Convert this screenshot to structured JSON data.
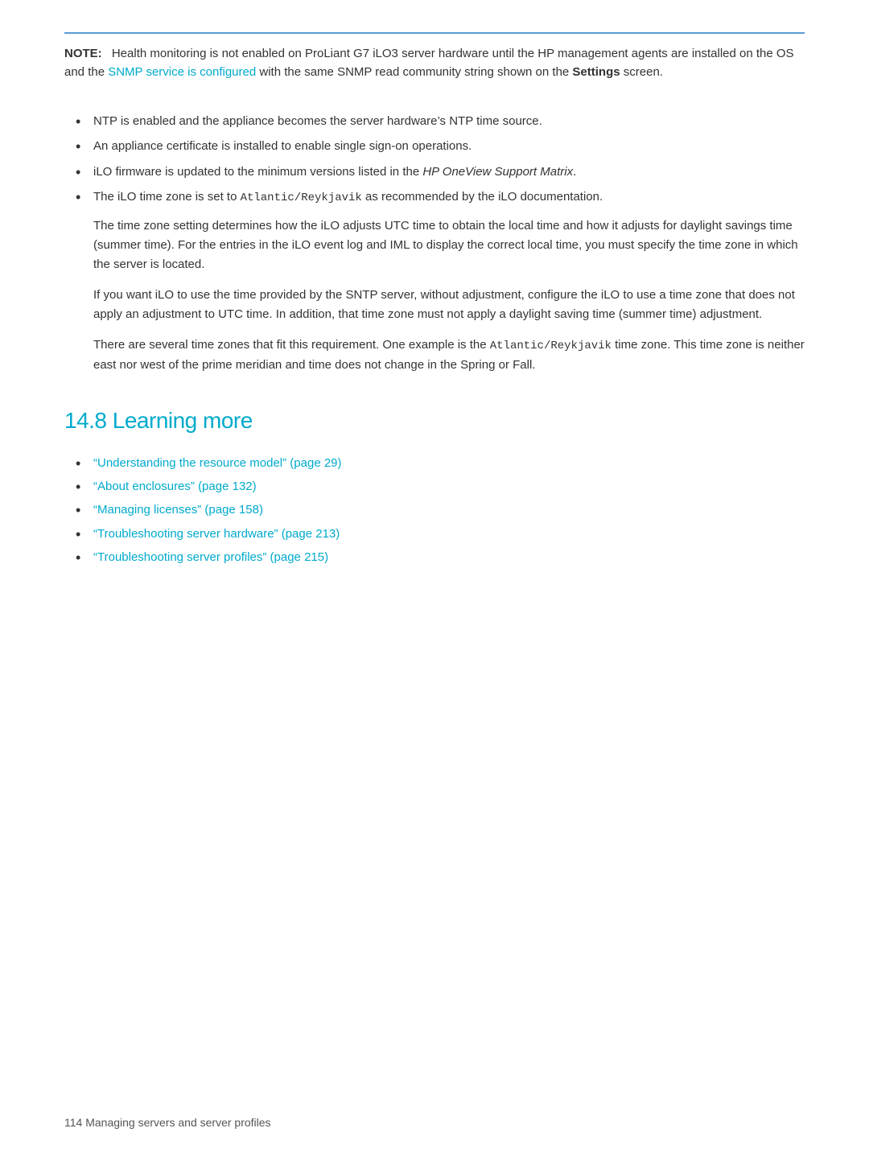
{
  "note": {
    "label": "NOTE:",
    "text": "Health monitoring is not enabled on ProLiant G7 iLO3 server hardware until the HP management agents are installed on the OS and the ",
    "link_text": "SNMP service is configured",
    "text2": " with the same SNMP read community string shown on the ",
    "bold_text": "Settings",
    "text3": " screen."
  },
  "bullets": [
    {
      "text": "NTP is enabled and the appliance becomes the server hardware’s NTP time source."
    },
    {
      "text": "An appliance certificate is installed to enable single sign-on operations."
    },
    {
      "text_before": "iLO firmware is updated to the minimum versions listed in the ",
      "italic_text": "HP OneView Support Matrix",
      "text_after": "."
    },
    {
      "text_before": "The iLO time zone is set to ",
      "mono_text": "Atlantic/Reykjavik",
      "text_after": " as recommended by the iLO documentation."
    }
  ],
  "sub_paragraphs": [
    "The time zone setting determines how the iLO adjusts UTC time to obtain the local time and how it adjusts for daylight savings time (summer time). For the entries in the iLO event log and IML to display the correct local time, you must specify the time zone in which the server is located.",
    "If you want iLO to use the time provided by the SNTP server, without adjustment, configure the iLO to use a time zone that does not apply an adjustment to UTC time. In addition, that time zone must not apply a daylight saving time (summer time) adjustment.",
    "There are several time zones that fit this requirement. One example is the Atlantic/Reykjavik time zone. This time zone is neither east nor west of the prime meridian and time does not change in the Spring or Fall."
  ],
  "sub_para_3_mono": "Atlantic/Reykjavik",
  "section_heading": "14.8 Learning more",
  "learn_more_links": [
    "“Understanding the resource model” (page 29)",
    "“About enclosures” (page 132)",
    "“Managing licenses” (page 158)",
    "“Troubleshooting server hardware” (page 213)",
    "“Troubleshooting server profiles” (page 215)"
  ],
  "footer_text": "114    Managing servers and server profiles",
  "colors": {
    "link": "#00aacc",
    "heading": "#00aacc",
    "text": "#333333",
    "border_top": "#5b9bd5"
  }
}
